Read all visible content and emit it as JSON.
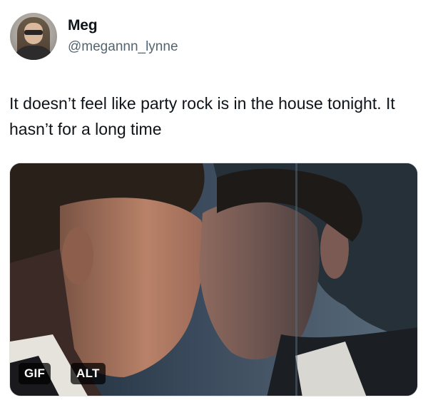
{
  "user": {
    "name": "Meg",
    "handle": "@megannn_lynne",
    "avatar_icon": "profile-photo"
  },
  "tweet": {
    "text": "It doesn’t feel like party rock is in the house tonight. It hasn’t for a long time"
  },
  "media": {
    "type": "gif",
    "gif_badge": "GIF",
    "alt_badge": "ALT"
  },
  "colors": {
    "text_primary": "#0f1419",
    "text_secondary": "#536471",
    "badge_bg": "#000000"
  }
}
